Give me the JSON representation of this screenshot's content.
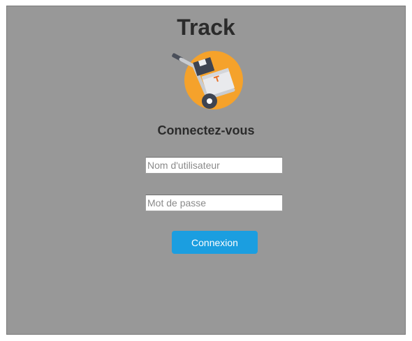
{
  "app": {
    "title": "Track",
    "logo_icon": "hand-truck-icon"
  },
  "login": {
    "heading": "Connectez-vous",
    "username_placeholder": "Nom d'utilisateur",
    "username_value": "",
    "password_placeholder": "Mot de passe",
    "password_value": "",
    "submit_label": "Connexion"
  },
  "colors": {
    "panel_background": "#989898",
    "button": "#1b9ee0",
    "logo_circle": "#f5a22b",
    "text": "#2b2b2b"
  }
}
